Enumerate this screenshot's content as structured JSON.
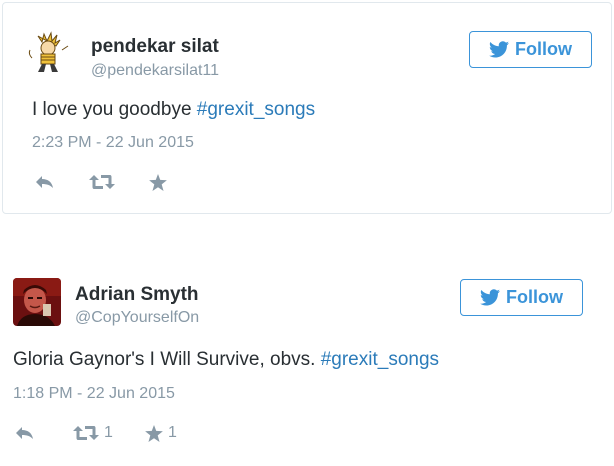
{
  "tweets": [
    {
      "name": "pendekar silat",
      "handle": "@pendekarsilat11",
      "follow_label": "Follow",
      "text_plain": "I love you goodbye ",
      "hashtag": "#grexit_songs",
      "timestamp": "2:23 PM - 22 Jun 2015",
      "retweet_count": "",
      "favorite_count": "",
      "avatar_icon": "calvin-cartoon-avatar"
    },
    {
      "name": "Adrian Smyth",
      "handle": "@CopYourselfOn",
      "follow_label": "Follow",
      "text_plain": "Gloria Gaynor's I Will Survive, obvs. ",
      "hashtag": "#grexit_songs",
      "timestamp": "1:18 PM - 22 Jun 2015",
      "retweet_count": "1",
      "favorite_count": "1",
      "avatar_icon": "person-photo-avatar"
    }
  ],
  "colors": {
    "accent": "#3b94d9",
    "hashtag": "#2b7bb9",
    "muted": "#8899a6",
    "text": "#292f33",
    "border": "#e1e8ed"
  }
}
